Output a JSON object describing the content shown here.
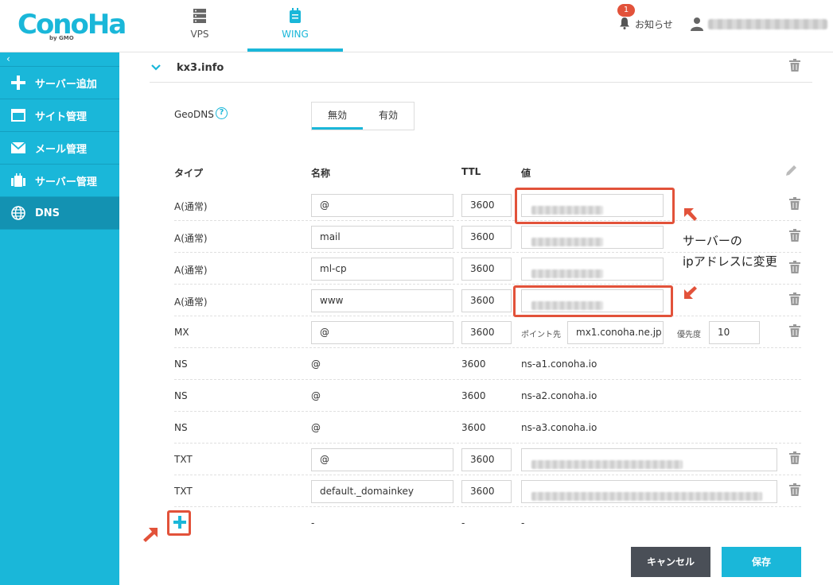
{
  "header": {
    "logo_text": "ConoHa",
    "logo_sub": "by GMO",
    "tabs": [
      {
        "label": "VPS",
        "icon": "server-icon"
      },
      {
        "label": "WING",
        "icon": "wing-icon"
      }
    ],
    "notice_label": "お知らせ",
    "notice_count": "1"
  },
  "sidebar": {
    "toggle": "‹",
    "items": [
      {
        "label": "サーバー追加",
        "icon": "plus-icon"
      },
      {
        "label": "サイト管理",
        "icon": "window-icon"
      },
      {
        "label": "メール管理",
        "icon": "mail-icon"
      },
      {
        "label": "サーバー管理",
        "icon": "server-manage-icon"
      },
      {
        "label": "DNS",
        "icon": "globe-icon"
      }
    ]
  },
  "domain": {
    "name": "kx3.info",
    "geodns_label": "GeoDNS",
    "geodns_help": "?",
    "geodns_options": [
      "無効",
      "有効"
    ]
  },
  "table": {
    "headers": {
      "type": "タイプ",
      "name": "名称",
      "ttl": "TTL",
      "value": "値"
    },
    "rows": [
      {
        "type": "A(通常)",
        "name": "@",
        "ttl": "3600"
      },
      {
        "type": "A(通常)",
        "name": "mail",
        "ttl": "3600"
      },
      {
        "type": "A(通常)",
        "name": "ml-cp",
        "ttl": "3600"
      },
      {
        "type": "A(通常)",
        "name": "www",
        "ttl": "3600"
      },
      {
        "type": "MX",
        "name": "@",
        "ttl": "3600",
        "point_label": "ポイント先",
        "point_value": "mx1.conoha.ne.jp",
        "priority_label": "優先度",
        "priority_value": "10"
      },
      {
        "type": "NS",
        "name": "@",
        "ttl": "3600",
        "value": "ns-a1.conoha.io"
      },
      {
        "type": "NS",
        "name": "@",
        "ttl": "3600",
        "value": "ns-a2.conoha.io"
      },
      {
        "type": "NS",
        "name": "@",
        "ttl": "3600",
        "value": "ns-a3.conoha.io"
      },
      {
        "type": "TXT",
        "name": "@",
        "ttl": "3600"
      },
      {
        "type": "TXT",
        "name": "default._domainkey",
        "ttl": "3600"
      }
    ],
    "new_row": {
      "name": "-",
      "ttl": "-",
      "value": "-"
    }
  },
  "annotation": {
    "line1": "サーバーの",
    "line2": "ipアドレスに変更"
  },
  "buttons": {
    "cancel": "キャンセル",
    "save": "保存"
  },
  "colors": {
    "accent": "#1ab7d9",
    "sidebar_active": "#1392b2",
    "annotation": "#e2523a",
    "cancel": "#4a4f57"
  }
}
